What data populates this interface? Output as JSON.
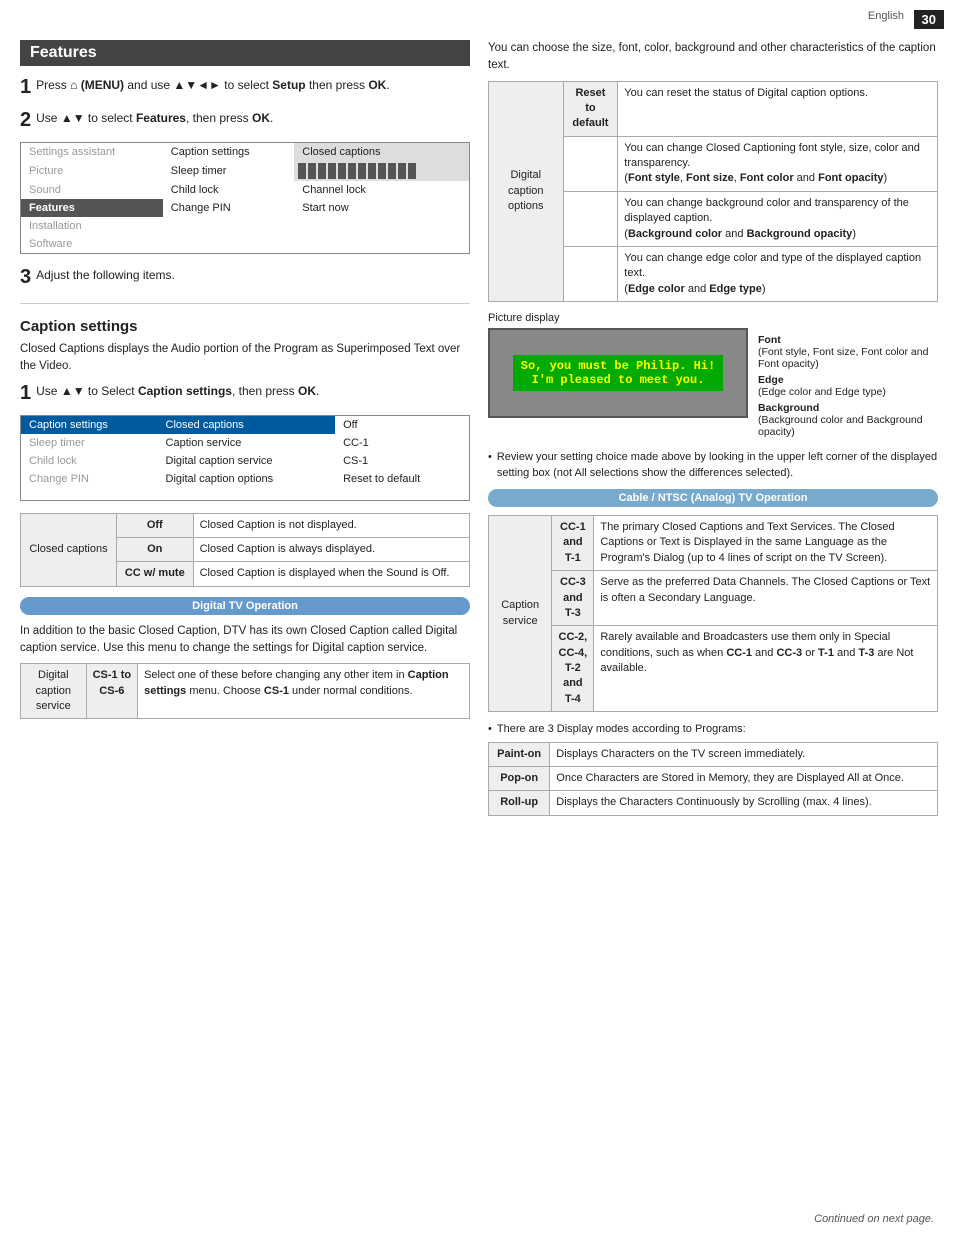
{
  "page": {
    "number": "30",
    "language": "English"
  },
  "left": {
    "features_title": "Features",
    "step1": {
      "num": "1",
      "text": "Press",
      "menu_icon": "⌂",
      "menu_label": "(MENU) and use ▲▼◄► to select Setup then press OK."
    },
    "step2": {
      "num": "2",
      "text": "Use ▲▼ to select Features, then press OK."
    },
    "menu": {
      "col1": [
        "Settings assistant",
        "Picture",
        "Sound",
        "Features",
        "Installation",
        "Software"
      ],
      "col2": [
        "Caption settings",
        "Sleep timer",
        "Child lock",
        "Change PIN"
      ],
      "col3_label": "Closed captions",
      "col3_items": [
        "",
        "",
        "",
        ""
      ]
    },
    "step3": {
      "num": "3",
      "text": "Adjust the following items."
    },
    "caption_settings_title": "Caption settings",
    "caption_desc1": "Closed Captions displays the Audio portion of the Program as Superimposed Text over the Video.",
    "caption_step1": {
      "num": "1",
      "text": "Use ▲▼ to Select Caption settings, then press OK."
    },
    "caption_menu": {
      "col1": [
        "Caption settings",
        "Sleep timer",
        "Child lock",
        "Change PIN"
      ],
      "col2": [
        "Closed captions",
        "Caption service",
        "Digital caption service",
        "Digital caption options"
      ],
      "col3": [
        "Off",
        "CC-1",
        "CS-1",
        "Reset to default"
      ]
    },
    "closed_captions_table": {
      "label": "Closed captions",
      "rows": [
        {
          "option": "Off",
          "desc": "Closed Caption is not displayed."
        },
        {
          "option": "On",
          "desc": "Closed Caption is always displayed."
        },
        {
          "option": "CC w/ mute",
          "desc": "Closed Caption is displayed when the Sound is Off."
        }
      ]
    },
    "digital_tv_banner": "Digital TV Operation",
    "digital_tv_text1": "In addition to the basic Closed Caption, DTV has its own Closed Caption called Digital caption service. Use this menu to change the settings for Digital caption service.",
    "digital_caption_service_table": {
      "label_line1": "Digital caption",
      "label_line2": "service",
      "cs_range": "CS-1 to CS-6",
      "desc": "Select one of these before changing any other item in Caption settings menu. Choose CS-1 under normal conditions."
    }
  },
  "right": {
    "intro": "You can choose the size, font, color, background and other characteristics of the caption text.",
    "digital_caption_options_table": {
      "label_line1": "Digital caption",
      "label_line2": "options",
      "rows": [
        {
          "key": "Reset to default",
          "desc": "You can reset the status of Digital caption options."
        },
        {
          "key": "",
          "desc": "You can change Closed Captioning font style, size, color and transparency. (Font style, Font size, Font color and Font opacity)"
        },
        {
          "key": "",
          "desc": "You can change background color and transparency of the displayed caption. (Background color and Background opacity)"
        },
        {
          "key": "",
          "desc": "You can change edge color and type of the displayed caption text. (Edge color and Edge type)"
        }
      ]
    },
    "picture_display_label": "Picture display",
    "caption_display_text1": "So, you must be Philip. Hi!",
    "caption_display_text2": "I'm pleased to meet you.",
    "font_label": "Font",
    "font_desc": "(Font style, Font size, Font color and Font opacity)",
    "edge_label": "Edge",
    "edge_desc": "(Edge color and Edge type)",
    "background_label": "Background",
    "background_desc": "(Background color and Background opacity)",
    "review_bullet": "Review your setting choice made above by looking in the upper left corner of the displayed setting box (not All selections show the differences selected).",
    "cable_ntsc_banner": "Cable / NTSC (Analog) TV Operation",
    "caption_service_table": {
      "label": "Caption service",
      "rows": [
        {
          "channel": "CC-1 and T-1",
          "desc": "The primary Closed Captions and Text Services. The Closed Captions or Text is Displayed in the same Language as the Program's Dialog (up to 4 lines of script on the TV Screen)."
        },
        {
          "channel": "CC-3 and T-3",
          "desc": "Serve as the preferred Data Channels. The Closed Captions or Text is often a Secondary Language."
        },
        {
          "channel": "CC-2, CC-4, T-2 and T-4",
          "desc": "Rarely available and Broadcasters use them only in Special conditions, such as when CC-1 and CC-3 or T-1 and T-3 are Not available."
        }
      ]
    },
    "display_modes_label": "There are 3 Display modes according to Programs:",
    "display_modes": [
      {
        "mode": "Paint-on",
        "desc": "Displays Characters on the TV screen immediately."
      },
      {
        "mode": "Pop-on",
        "desc": "Once Characters are Stored in Memory, they are Displayed All at Once."
      },
      {
        "mode": "Roll-up",
        "desc": "Displays the Characters Continuously by Scrolling (max. 4 lines)."
      }
    ],
    "continued": "Continued on next page."
  }
}
